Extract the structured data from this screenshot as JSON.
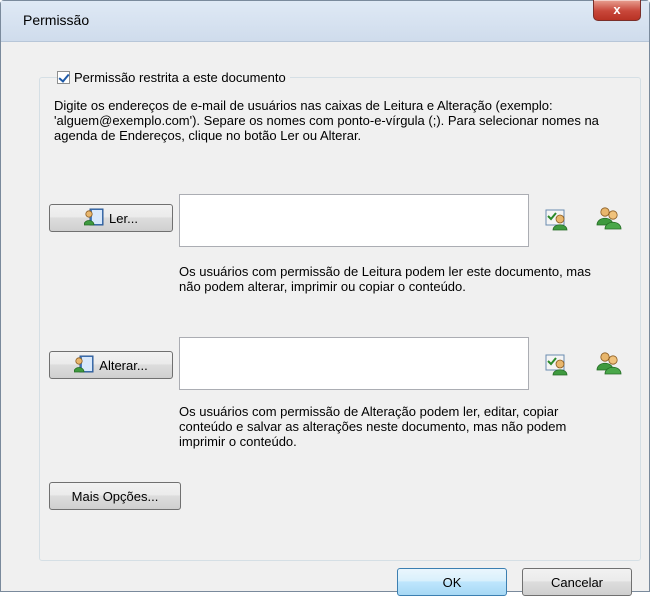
{
  "window": {
    "title": "Permissão",
    "close_glyph": "x"
  },
  "group": {
    "checkbox_label": "Permissão restrita a este documento",
    "checked": true
  },
  "instructions": "Digite os endereços de e-mail de usuários nas caixas de Leitura e Alteração (exemplo: 'alguem@exemplo.com'). Separe os nomes com ponto-e-vírgula (;). Para selecionar nomes na agenda de Endereços, clique no botão Ler ou Alterar.",
  "read": {
    "button_label": "Ler...",
    "input_value": "",
    "description": "Os usuários com permissão de Leitura podem ler este documento, mas não podem alterar, imprimir ou copiar o conteúdo.",
    "icons": [
      "address-book-icon",
      "check-names-icon",
      "users-icon"
    ]
  },
  "change": {
    "button_label": "Alterar...",
    "input_value": "",
    "description": "Os usuários com permissão de Alteração podem ler, editar, copiar conteúdo e salvar as alterações neste documento, mas não podem imprimir o conteúdo.",
    "icons": [
      "address-book-icon",
      "check-names-icon",
      "users-icon"
    ]
  },
  "more_options_label": "Mais Opções...",
  "footer": {
    "ok_label": "OK",
    "cancel_label": "Cancelar"
  },
  "colors": {
    "accent": "#3c7fb1",
    "close": "#c8473a",
    "titlebar": "#dfe9f5"
  }
}
